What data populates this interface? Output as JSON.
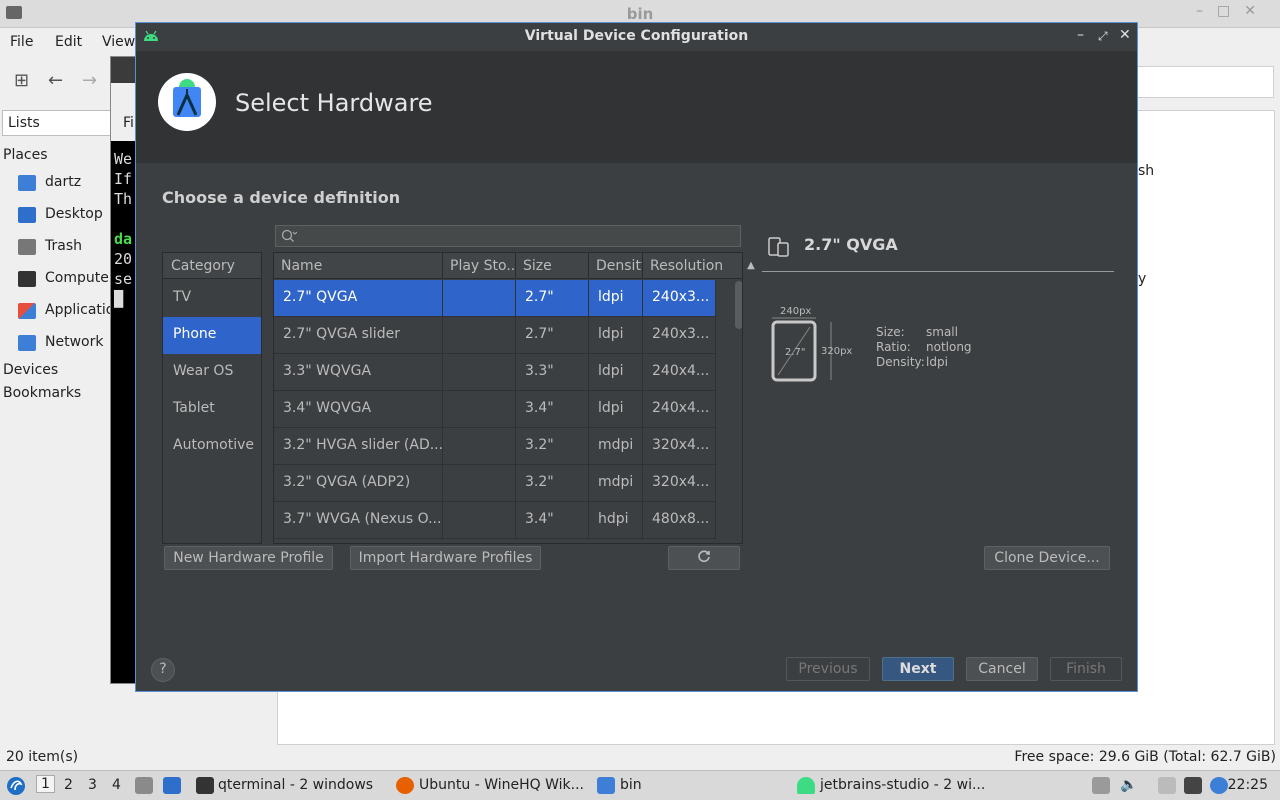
{
  "file_manager": {
    "title": "bin",
    "menu": [
      "File",
      "Edit",
      "View"
    ],
    "lists_label": "Lists",
    "places_label": "Places",
    "places": [
      {
        "label": "dartz",
        "icon": "home-icon",
        "color": "#3d7fd6"
      },
      {
        "label": "Desktop",
        "icon": "desktop-icon",
        "color": "#2d6fcb"
      },
      {
        "label": "Trash",
        "icon": "trash-icon",
        "color": "#777777"
      },
      {
        "label": "Computer",
        "icon": "computer-icon",
        "color": "#333333"
      },
      {
        "label": "Applications",
        "icon": "applications-icon",
        "color": "#e84e3c"
      },
      {
        "label": "Network",
        "icon": "network-icon",
        "color": "#3d7fd6"
      }
    ],
    "devices_label": "Devices",
    "bookmarks_label": "Bookmarks",
    "content_fragments": [
      "sh",
      "y"
    ],
    "status_left": "20 item(s)",
    "status_right": "Free space: 29.6 GiB (Total: 62.7 GiB)"
  },
  "terminal": {
    "tab_label": "Fi",
    "lines": [
      "We",
      "If",
      "Th",
      "",
      "da",
      "20",
      "se"
    ]
  },
  "dialog": {
    "title": "Virtual Device Configuration",
    "header_title": "Select Hardware",
    "section_title": "Choose a device definition",
    "search": {
      "value": "",
      "placeholder": ""
    },
    "category_header": "Category",
    "categories": [
      {
        "label": "TV",
        "selected": false
      },
      {
        "label": "Phone",
        "selected": true
      },
      {
        "label": "Wear OS",
        "selected": false
      },
      {
        "label": "Tablet",
        "selected": false
      },
      {
        "label": "Automotive",
        "selected": false
      }
    ],
    "columns": [
      "Name",
      "Play Sto...",
      "Size",
      "Density",
      "Resolution"
    ],
    "devices": [
      {
        "name": "2.7\" QVGA",
        "play": "",
        "size": "2.7\"",
        "density": "ldpi",
        "resolution": "240x3...",
        "selected": true
      },
      {
        "name": "2.7\" QVGA slider",
        "play": "",
        "size": "2.7\"",
        "density": "ldpi",
        "resolution": "240x3...",
        "selected": false
      },
      {
        "name": "3.3\" WQVGA",
        "play": "",
        "size": "3.3\"",
        "density": "ldpi",
        "resolution": "240x4...",
        "selected": false
      },
      {
        "name": "3.4\" WQVGA",
        "play": "",
        "size": "3.4\"",
        "density": "ldpi",
        "resolution": "240x4...",
        "selected": false
      },
      {
        "name": "3.2\" HVGA slider (AD...",
        "play": "",
        "size": "3.2\"",
        "density": "mdpi",
        "resolution": "320x4...",
        "selected": false
      },
      {
        "name": "3.2\" QVGA (ADP2)",
        "play": "",
        "size": "3.2\"",
        "density": "mdpi",
        "resolution": "320x4...",
        "selected": false
      },
      {
        "name": "3.7\" WVGA (Nexus O...",
        "play": "",
        "size": "3.4\"",
        "density": "hdpi",
        "resolution": "480x8...",
        "selected": false
      }
    ],
    "details": {
      "title": "2.7\" QVGA",
      "width_px": "240px",
      "height_px": "320px",
      "diagonal": "2.7\"",
      "specs": [
        {
          "key": "Size:",
          "value": "small"
        },
        {
          "key": "Ratio:",
          "value": "notlong"
        },
        {
          "key": "Density:",
          "value": "ldpi"
        }
      ]
    },
    "buttons": {
      "new_profile": "New Hardware Profile",
      "import_profiles": "Import Hardware Profiles",
      "clone": "Clone Device...",
      "previous": "Previous",
      "next": "Next",
      "cancel": "Cancel",
      "finish": "Finish",
      "help": "?"
    }
  },
  "taskbar": {
    "workspaces": [
      "1",
      "2",
      "3",
      "4"
    ],
    "tasks": [
      "qterminal - 2 windows",
      "Ubuntu - WineHQ Wik...",
      "bin",
      "jetbrains-studio - 2 wi..."
    ],
    "clock": "22:25"
  },
  "colors": {
    "selection": "#2f65ca",
    "dialog_bg": "#3c3f41",
    "header_bg": "#313335",
    "primary_button": "#365880"
  }
}
